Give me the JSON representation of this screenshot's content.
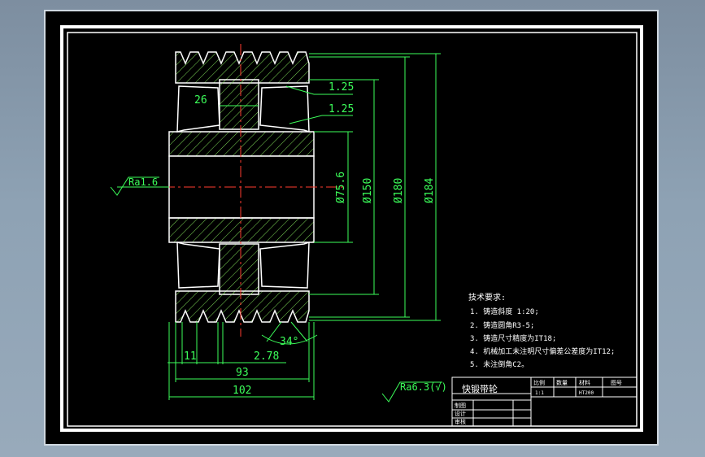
{
  "drawing": {
    "dimensions": {
      "taper1": "1.25",
      "taper2": "1.25",
      "groove_width": "26",
      "bore": "Ø75.6",
      "d150": "Ø150",
      "d180": "Ø180",
      "d184": "Ø184",
      "rib": "11",
      "pitch": "2.78",
      "angle": "34°",
      "span93": "93",
      "width102": "102"
    },
    "roughness": {
      "bore": "Ra1.6",
      "general": "Ra6.3(√)"
    },
    "tech_requirements": {
      "title": "技术要求:",
      "items": [
        "1. 铸造斜度 1:20;",
        "2. 铸造圆角R3-5;",
        "3. 铸造尺寸精度为IT18;",
        "4. 机械加工未注明尺寸偏差公差度为IT12;",
        "5. 未注倒角C2。"
      ]
    },
    "title_block": {
      "part_name": "快锻带轮",
      "col_scale": "比例",
      "col_qty": "数量",
      "col_material": "材料",
      "col_drawing_no": "图号",
      "scale": "1:1",
      "material": "HT200",
      "row_drawn": "制图",
      "row_designed": "设计",
      "row_checked": "审核"
    }
  },
  "colors": {
    "outline": "#ffffff",
    "hatch": "#7ed957",
    "dimension": "#3cff5a",
    "centerline": "#ff3b30",
    "text": "#ffffff"
  }
}
